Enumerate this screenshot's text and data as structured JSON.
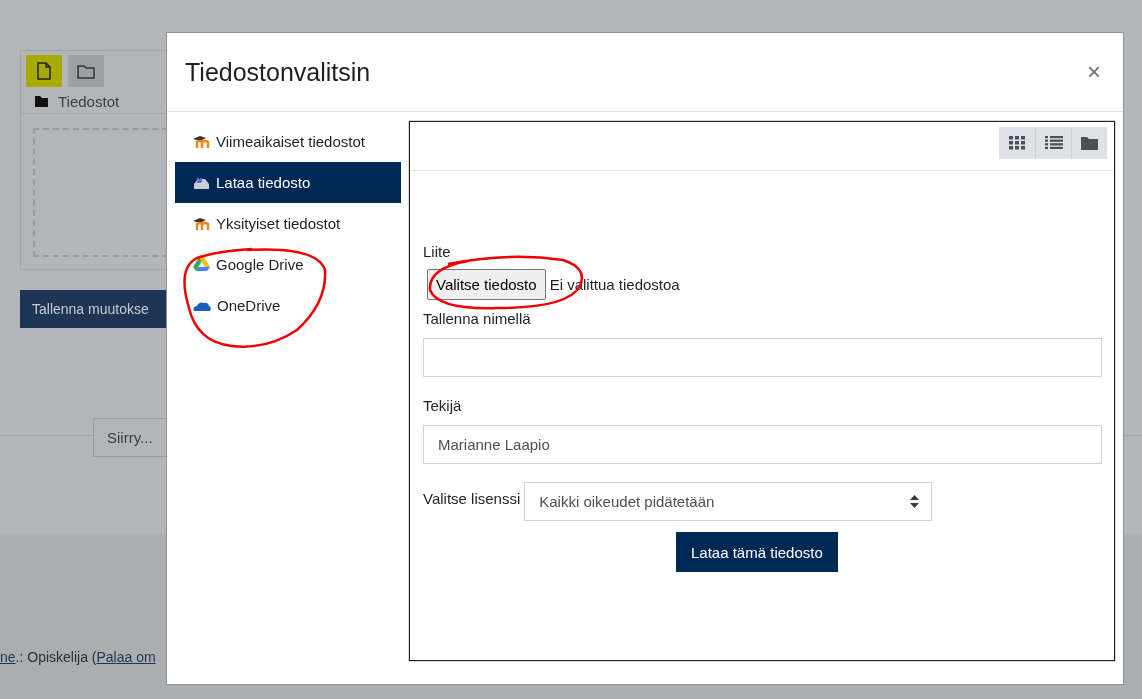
{
  "background_page": {
    "toolbar_buttons": [
      {
        "kind": "file",
        "selected": true
      },
      {
        "kind": "folder",
        "selected": false
      }
    ],
    "path": "Tiedostot",
    "save_button": "Tallenna muutokse",
    "jump_select": "Siirry...",
    "footer": {
      "role_link": "ne",
      "text": ".: Opiskelija (",
      "return_link": "Palaa om"
    }
  },
  "modal": {
    "title": "Tiedostonvalitsin",
    "close": "×",
    "sidebar": [
      {
        "label": "Viimeaikaiset tiedostot",
        "kind": "moodle",
        "selected": false
      },
      {
        "label": "Lataa tiedosto",
        "kind": "upload",
        "selected": true
      },
      {
        "label": "Yksityiset tiedostot",
        "kind": "moodle",
        "selected": false
      },
      {
        "label": "Google Drive",
        "kind": "gdrive",
        "selected": false
      },
      {
        "label": "OneDrive",
        "kind": "onedrive",
        "selected": false
      }
    ],
    "view_buttons": [
      {
        "kind": "grid"
      },
      {
        "kind": "list"
      },
      {
        "kind": "tree"
      }
    ],
    "form": {
      "attachment_label": "Liite",
      "choose_button": "Valitse tiedosto",
      "no_file_text": "Ei valittua tiedostoa",
      "save_as_label": "Tallenna nimellä",
      "author_label": "Tekijä",
      "author_value": "Marianne Laapio",
      "license_label": "Valitse lisenssi",
      "license_value": "Kaikki oikeudet pidätetään",
      "upload_button": "Lataa tämä tiedosto"
    }
  }
}
